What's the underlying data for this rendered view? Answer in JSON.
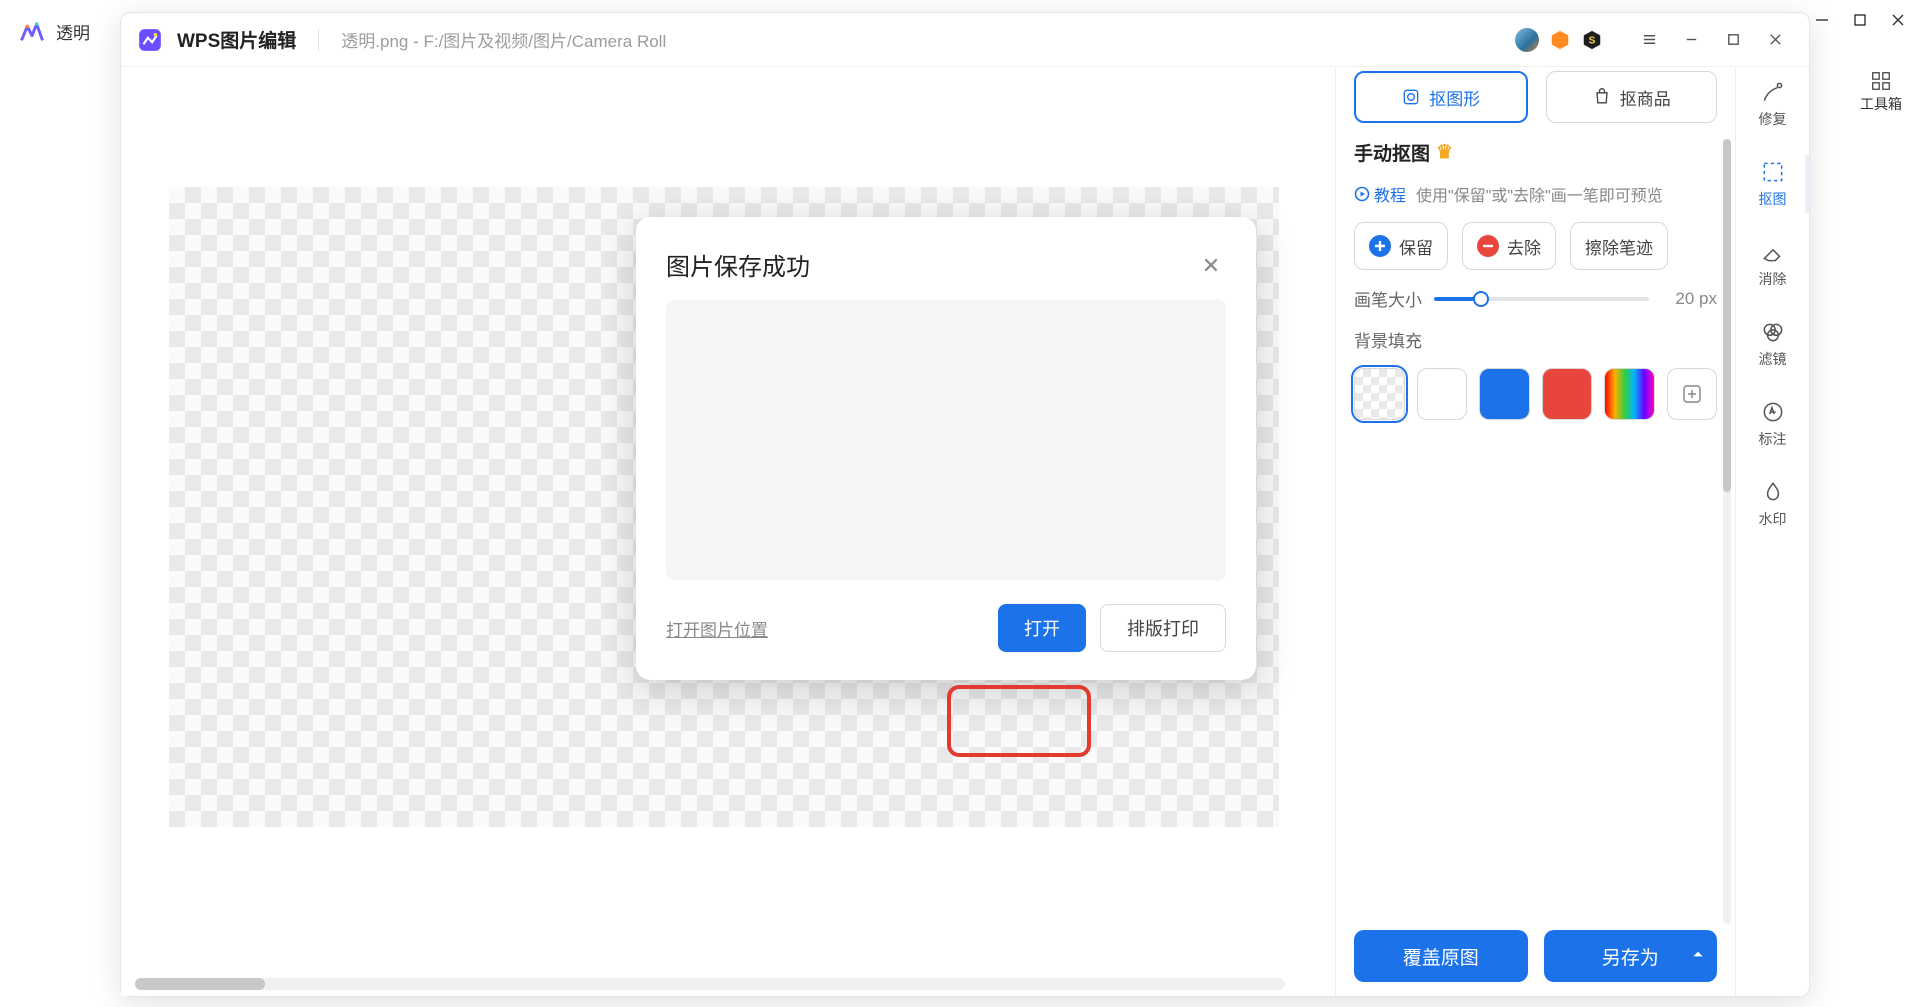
{
  "outer": {
    "title": "透明"
  },
  "toolbox_label": "工具箱",
  "titlebar": {
    "app": "WPS图片编辑",
    "path": "透明.png - F:/图片及视频/图片/Camera Roll"
  },
  "chips": {
    "shape": "抠图形",
    "product": "抠商品"
  },
  "manual": {
    "title": "手动抠图",
    "tutorial": "教程",
    "hint": "使用\"保留\"或\"去除\"画一笔即可预览"
  },
  "tools": {
    "keep": "保留",
    "remove": "去除",
    "erase": "擦除笔迹"
  },
  "slider": {
    "label": "画笔大小",
    "value": "20",
    "unit": "px"
  },
  "bg": {
    "title": "背景填充",
    "colors": {
      "white": "#ffffff",
      "blue": "#1c72e8",
      "red": "#e8453c"
    }
  },
  "footer": {
    "overwrite": "覆盖原图",
    "saveas": "另存为"
  },
  "dialog": {
    "title": "图片保存成功",
    "open_location": "打开图片位置",
    "open": "打开",
    "print": "排版打印"
  },
  "rail": {
    "repair": "修复",
    "cutout": "抠图",
    "eraser": "消除",
    "filter": "滤镜",
    "annotate": "标注",
    "watermark": "水印"
  }
}
